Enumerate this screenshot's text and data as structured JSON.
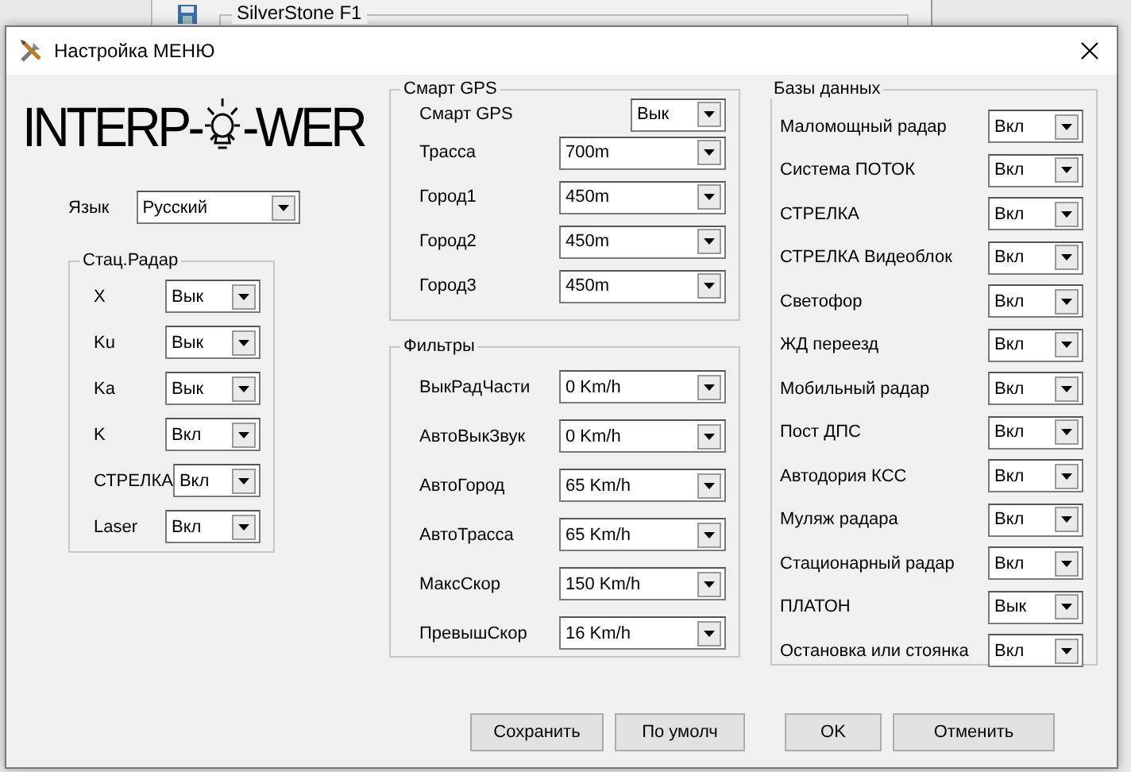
{
  "background": {
    "window_title": "SilverStone F1"
  },
  "dialog": {
    "title": "Настройка МЕНЮ"
  },
  "logo": {
    "left": "INTERP-",
    "right": "-WER"
  },
  "language": {
    "label": "Язык",
    "value": "Русский"
  },
  "groups": [
    {
      "title": "Стац.Радар",
      "rows": [
        {
          "label": "X",
          "value": "Вык"
        },
        {
          "label": "Ku",
          "value": "Вык"
        },
        {
          "label": "Ka",
          "value": "Вык"
        },
        {
          "label": "K",
          "value": "Вкл"
        },
        {
          "label": "СТРЕЛКА",
          "value": "Вкл"
        },
        {
          "label": "Laser",
          "value": "Вкл"
        }
      ]
    },
    {
      "title": "Смарт GPS",
      "rows": [
        {
          "label": "Смарт GPS",
          "value": "Вык"
        },
        {
          "label": "Трасса",
          "value": "700m"
        },
        {
          "label": "Город1",
          "value": "450m"
        },
        {
          "label": "Город2",
          "value": "450m"
        },
        {
          "label": "Город3",
          "value": "450m"
        }
      ]
    },
    {
      "title": "Фильтры",
      "rows": [
        {
          "label": "ВыкРадЧасти",
          "value": "0 Km/h"
        },
        {
          "label": "АвтоВыкЗвук",
          "value": "0 Km/h"
        },
        {
          "label": "АвтоГород",
          "value": "65 Km/h"
        },
        {
          "label": "АвтоТрасса",
          "value": "65 Km/h"
        },
        {
          "label": "МаксСкор",
          "value": "150 Km/h"
        },
        {
          "label": "ПревышСкор",
          "value": "16 Km/h"
        }
      ]
    },
    {
      "title": "Базы данных",
      "rows": [
        {
          "label": "Маломощный радар",
          "value": "Вкл"
        },
        {
          "label": "Система ПОТОК",
          "value": "Вкл"
        },
        {
          "label": "СТРЕЛКА",
          "value": "Вкл"
        },
        {
          "label": "СТРЕЛКА Видеоблок",
          "value": "Вкл"
        },
        {
          "label": "Светофор",
          "value": "Вкл"
        },
        {
          "label": "ЖД переезд",
          "value": "Вкл"
        },
        {
          "label": "Мобильный радар",
          "value": "Вкл"
        },
        {
          "label": "Пост ДПС",
          "value": "Вкл"
        },
        {
          "label": "Автодория КСС",
          "value": "Вкл"
        },
        {
          "label": "Муляж радара",
          "value": "Вкл"
        },
        {
          "label": "Стационарный радар",
          "value": "Вкл"
        },
        {
          "label": "ПЛАТОН",
          "value": "Вык"
        },
        {
          "label": "Остановка или стоянка",
          "value": "Вкл"
        }
      ]
    }
  ],
  "buttons": [
    "Сохранить",
    "По умолч",
    "OK",
    "Отменить"
  ]
}
